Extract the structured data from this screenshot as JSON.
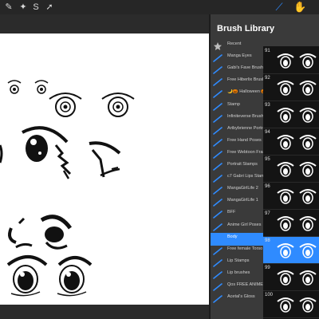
{
  "toolbar": {
    "left_tools": [
      {
        "name": "wrench-icon",
        "glyph": "✎"
      },
      {
        "name": "magic-wand-icon",
        "glyph": "✦"
      },
      {
        "name": "selection-icon",
        "glyph": "S"
      },
      {
        "name": "transform-icon",
        "glyph": "➚"
      }
    ],
    "right_tools": [
      {
        "name": "brush-icon",
        "glyph": "⟋",
        "active": true
      },
      {
        "name": "smudge-icon",
        "glyph": "✋",
        "active": false
      }
    ]
  },
  "brush_library": {
    "title": "Brush Library",
    "categories": [
      {
        "label": "Recent",
        "icon": "star-icon"
      },
      {
        "label": "Manga Eyes",
        "icon": "brush-set-icon"
      },
      {
        "label": "Gabi's Fave Brush",
        "icon": "brush-set-icon"
      },
      {
        "label": "Free Hiberlix Brushes",
        "icon": "brush-set-icon"
      },
      {
        "label": "🌙🎃 Halloween 🎃🌙",
        "icon": "brush-set-icon"
      },
      {
        "label": "Stamp",
        "icon": "brush-set-icon"
      },
      {
        "label": "Infiniteverse Brush...",
        "icon": "brush-set-icon"
      },
      {
        "label": "Artbybrienne Portrait",
        "icon": "brush-set-icon"
      },
      {
        "label": "Free Hand Poses",
        "icon": "brush-set-icon"
      },
      {
        "label": "Free Webtoon Frame",
        "icon": "brush-set-icon"
      },
      {
        "label": "Portrait Stamps",
        "icon": "brush-set-icon"
      },
      {
        "label": "c7 Gabri Lips Stamps",
        "icon": "brush-set-icon"
      },
      {
        "label": "MangaGirlLife 2",
        "icon": "brush-set-icon"
      },
      {
        "label": "MangaGirlLife 1",
        "icon": "brush-set-icon"
      },
      {
        "label": "BFF",
        "icon": "brush-set-icon"
      },
      {
        "label": "Anime Girl Poses",
        "icon": "brush-set-icon"
      },
      {
        "label": "Body",
        "icon": "brush-set-icon"
      },
      {
        "label": "Free female Torso",
        "icon": "brush-set-icon"
      },
      {
        "label": "Lip Stamps",
        "icon": "brush-set-icon"
      },
      {
        "label": "Lip brushes",
        "icon": "brush-set-icon"
      },
      {
        "label": "Qos FREE ANIME...",
        "icon": "brush-set-icon"
      },
      {
        "label": "Acetal's Gloss",
        "icon": "brush-set-icon"
      }
    ],
    "brushes": [
      {
        "number": "91",
        "active": false
      },
      {
        "number": "92",
        "active": false
      },
      {
        "number": "93",
        "active": false
      },
      {
        "number": "94",
        "active": false
      },
      {
        "number": "95",
        "active": false
      },
      {
        "number": "96",
        "active": false
      },
      {
        "number": "97",
        "active": false
      },
      {
        "number": "98",
        "active": true
      },
      {
        "number": "99",
        "active": false
      },
      {
        "number": "100",
        "active": false
      }
    ]
  }
}
